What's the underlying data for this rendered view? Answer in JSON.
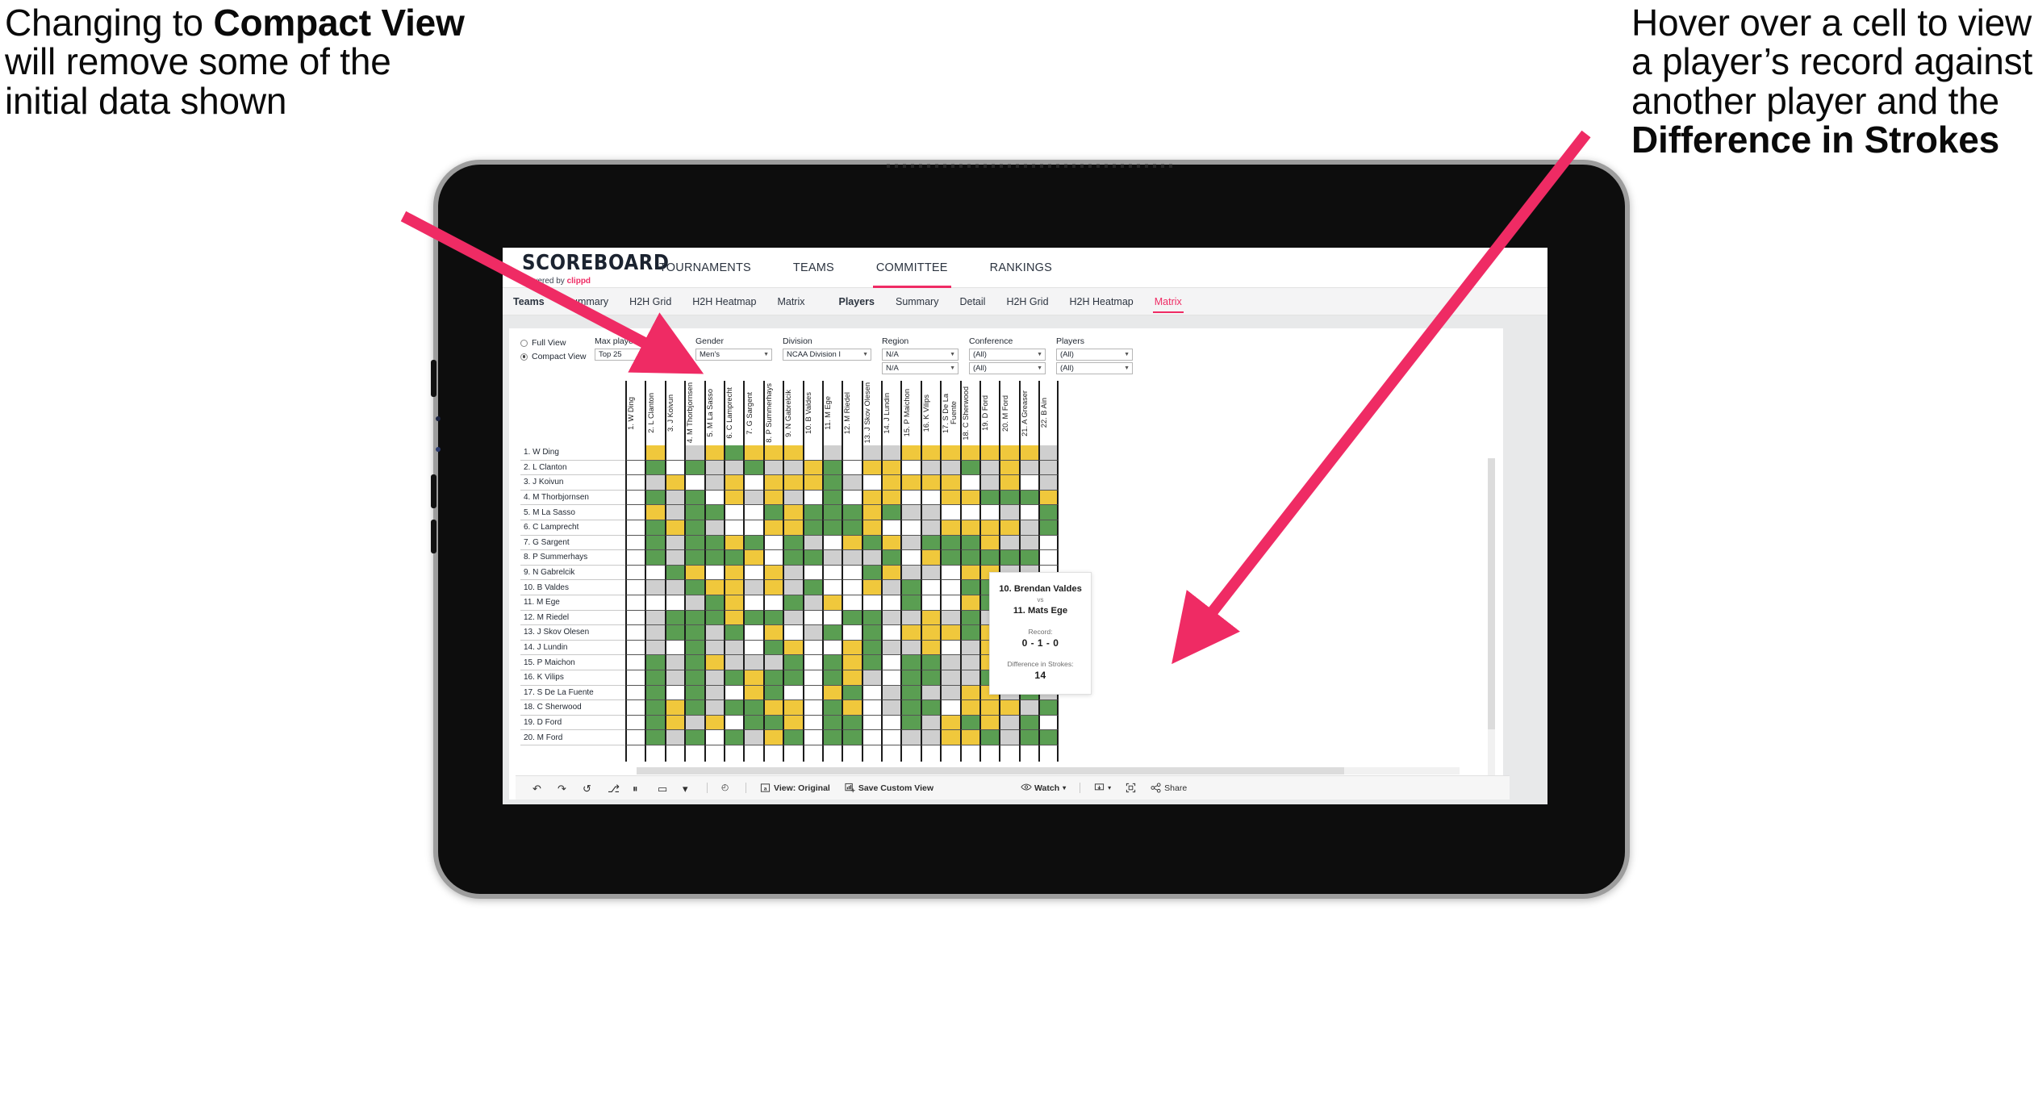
{
  "annotations": {
    "left": {
      "line1": "Changing to ",
      "bold": "Compact View",
      "line2": " will remove some of the initial data shown"
    },
    "right": {
      "line1": "Hover over a cell to view a player’s record against another player and the ",
      "bold": "Difference in Strokes"
    }
  },
  "app": {
    "brand": {
      "title": "SCOREBOARD",
      "powered_prefix": "Powered by ",
      "powered_brand": "clippd"
    },
    "topnav": [
      {
        "label": "TOURNAMENTS",
        "active": false
      },
      {
        "label": "TEAMS",
        "active": false
      },
      {
        "label": "COMMITTEE",
        "active": true
      },
      {
        "label": "RANKINGS",
        "active": false
      }
    ],
    "subnav_teams": [
      {
        "label": "Teams",
        "head": true,
        "active": false
      },
      {
        "label": "Summary",
        "head": false,
        "active": false
      },
      {
        "label": "H2H Grid",
        "head": false,
        "active": false
      },
      {
        "label": "H2H Heatmap",
        "head": false,
        "active": false
      },
      {
        "label": "Matrix",
        "head": false,
        "active": false
      }
    ],
    "subnav_players": [
      {
        "label": "Players",
        "head": true,
        "active": false
      },
      {
        "label": "Summary",
        "head": false,
        "active": false
      },
      {
        "label": "Detail",
        "head": false,
        "active": false
      },
      {
        "label": "H2H Grid",
        "head": false,
        "active": false
      },
      {
        "label": "H2H Heatmap",
        "head": false,
        "active": false
      },
      {
        "label": "Matrix",
        "head": false,
        "active": true
      }
    ],
    "accent_color": "#ef2b64"
  },
  "filters": {
    "view_modes": [
      {
        "label": "Full View",
        "selected": false
      },
      {
        "label": "Compact View",
        "selected": true
      }
    ],
    "selects": [
      {
        "label": "Max players in view",
        "value": "Top 25",
        "value2": null
      },
      {
        "label": "Gender",
        "value": "Men's",
        "value2": null
      },
      {
        "label": "Division",
        "value": "NCAA Division I",
        "value2": null
      },
      {
        "label": "Region",
        "value": "N/A",
        "value2": "N/A"
      },
      {
        "label": "Conference",
        "value": "(All)",
        "value2": "(All)"
      },
      {
        "label": "Players",
        "value": "(All)",
        "value2": "(All)"
      }
    ]
  },
  "matrix": {
    "columns": [
      "1. W Ding",
      "2. L Clanton",
      "3. J Koivun",
      "4. M Thorbjornsen",
      "5. M La Sasso",
      "6. C Lamprecht",
      "7. G Sargent",
      "8. P Summerhays",
      "9. N Gabrelcik",
      "10. B Valdes",
      "11. M Ege",
      "12. M Riedel",
      "13. J Skov Olesen",
      "14. J Lundin",
      "15. P Maichon",
      "16. K Vilips",
      "17. S De La Fuente",
      "18. C Sherwood",
      "19. D Ford",
      "20. M Ford",
      "21. A Greaser",
      "22. B Ain"
    ],
    "rows": [
      "1. W Ding",
      "2. L Clanton",
      "3. J Koivun",
      "4. M Thorbjornsen",
      "5. M La Sasso",
      "6. C Lamprecht",
      "7. G Sargent",
      "8. P Summerhays",
      "9. N Gabrelcik",
      "10. B Valdes",
      "11. M Ege",
      "12. M Riedel",
      "13. J Skov Olesen",
      "14. J Lundin",
      "15. P Maichon",
      "16. K Vilips",
      "17. S De La Fuente",
      "18. C Sherwood",
      "19. D Ford",
      "20. M Ford"
    ],
    "legend_colors": {
      "win": "#5a9e52",
      "loss": "#f0c83c",
      "tie": "#cfcfcf",
      "none": "#ffffff"
    },
    "cells": [
      "wywaygyyywawaayyyyyyya",
      "wgwgaagaaygwyywaagayaa",
      "wayway yyygawyyyyway ay",
      "wgagwyayawgwyywwyygggy",
      "wyaggwwgygggygaawwwawg",
      "wgygawwyygggywwayyyyag",
      "wgaggygwgawygyagggyaaw",
      "wgagggywggaaagwygggggw",
      "wwgywywyawwwgyaawyyaaw",
      "waagyyayagwwyagwwggyaa",
      "wwwagywwgaywwwgwwygggy",
      "wagggygganwggaayagaaga",
      "waggagwywagwgwyyygywga",
      "wawgaawgywwygaaywayyya",
      "wgagyaaagwgygwggaayyga",
      "wgagagyggwgyawggaaggga",
      "wgwgawygwwygwagaayyaga",
      "wgygaggyywgywaggwyyyag",
      "wgyaywggywggwwgaygyagw",
      "wgagwgaygwggwwaayygagg"
    ]
  },
  "tooltip": {
    "player_a": "10. Brendan Valdes",
    "vs": "vs",
    "player_b": "11. Mats Ege",
    "record_label": "Record:",
    "record_value": "0 - 1 - 0",
    "strokes_label": "Difference in Strokes:",
    "strokes_value": "14"
  },
  "toolbar": {
    "icons": [
      {
        "name": "undo-icon",
        "glyph": "↶"
      },
      {
        "name": "redo-icon",
        "glyph": "↷"
      },
      {
        "name": "revert-icon",
        "glyph": "↺"
      },
      {
        "name": "refresh-data-icon",
        "glyph": "⎇"
      },
      {
        "name": "pause-auto-update-icon",
        "glyph": "⏸"
      },
      {
        "name": "highlight-icon",
        "glyph": "▭"
      },
      {
        "name": "highlight-caret-icon",
        "glyph": "▾"
      }
    ],
    "clock_icon": "◴",
    "view_original": "View: Original",
    "save_custom_view": "Save Custom View",
    "watch": "Watch",
    "watch_caret": "▾",
    "download_caret": "▾",
    "share": "Share"
  }
}
